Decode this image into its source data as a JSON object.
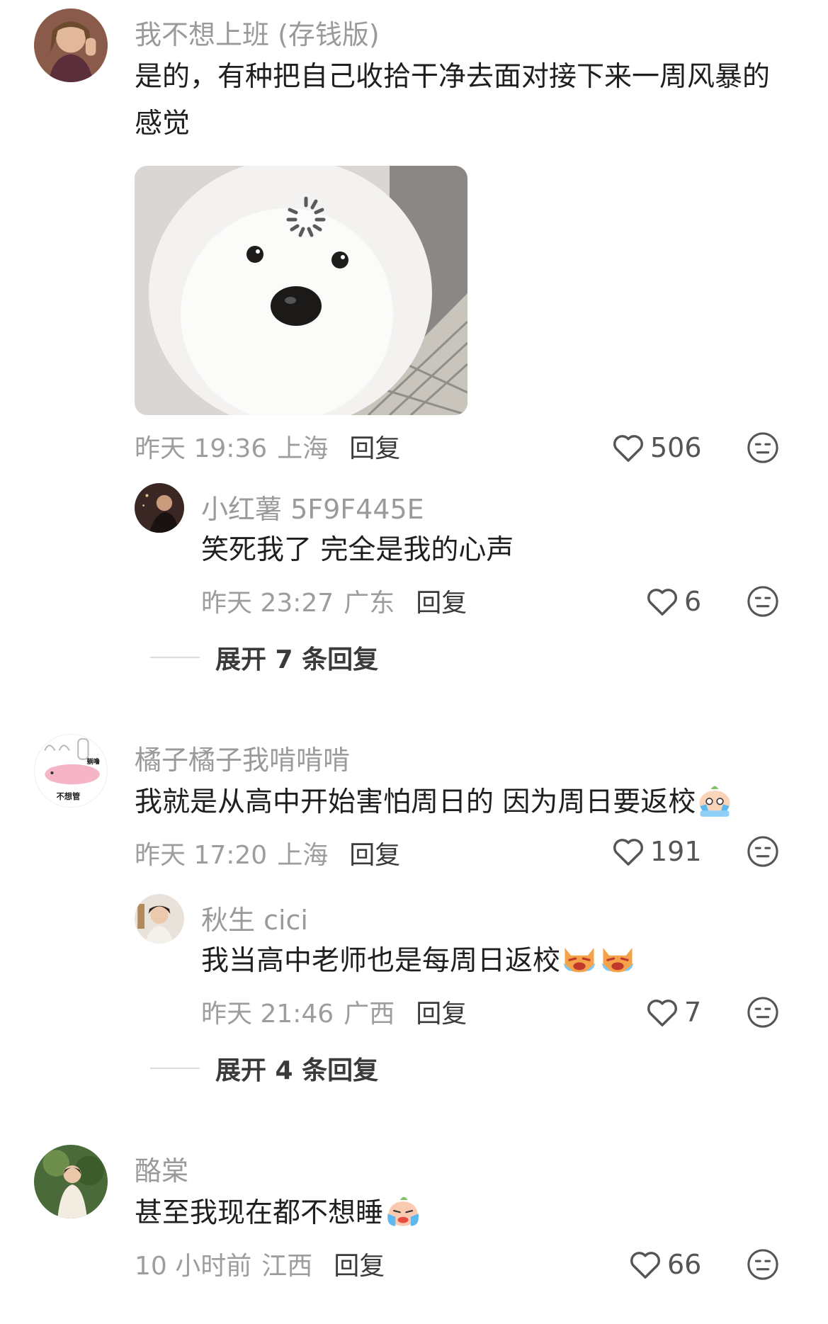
{
  "comments": [
    {
      "username": "我不想上班 (存钱版)",
      "text": "是的，有种把自己收拾干净去面对接下来一周风暴的感觉",
      "time": "昨天 19:36",
      "location": "上海",
      "reply_label": "回复",
      "likes": "506",
      "has_image": true,
      "replies": [
        {
          "username": "小红薯 5F9F445E",
          "text": "笑死我了 完全是我的心声",
          "time": "昨天 23:27",
          "location": "广东",
          "reply_label": "回复",
          "likes": "6"
        }
      ],
      "expand_label": "展开 7 条回复"
    },
    {
      "username": "橘子橘子我啃啃啃",
      "text": "我就是从高中开始害怕周日的 因为周日要返校",
      "time": "昨天 17:20",
      "location": "上海",
      "reply_label": "回复",
      "likes": "191",
      "avatar_sticker_text": "不想管",
      "avatar_sticker_text2": "躺噜",
      "replies": [
        {
          "username": "秋生 cici",
          "text": "我当高中老师也是每周日返校",
          "time": "昨天 21:46",
          "location": "广西",
          "reply_label": "回复",
          "likes": "7"
        }
      ],
      "expand_label": "展开 4 条回复"
    },
    {
      "username": "酪棠",
      "text": "甚至我现在都不想睡",
      "time": "10 小时前",
      "location": "江西",
      "reply_label": "回复",
      "likes": "66"
    }
  ],
  "colors": {
    "username": "#9a9a9a",
    "text": "#1f1f1f",
    "meta": "#9d9d9d",
    "divider": "#dcdcdc"
  },
  "icons": {
    "like": "heart-outline-icon",
    "emoji": "neutral-face-icon"
  }
}
